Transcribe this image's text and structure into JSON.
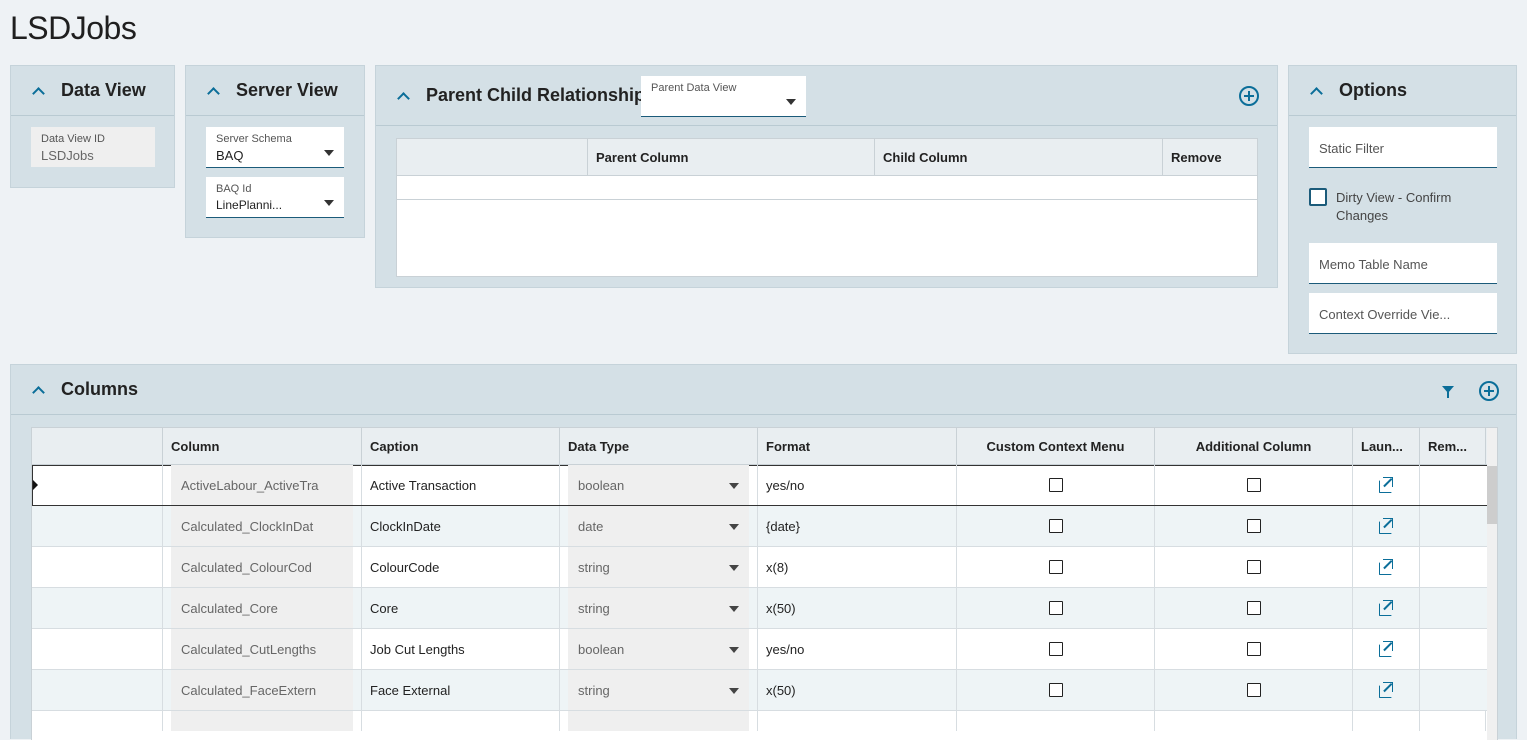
{
  "page": {
    "title": "LSDJobs"
  },
  "data_view": {
    "title": "Data View",
    "id_label": "Data View ID",
    "id_value": "LSDJobs"
  },
  "server_view": {
    "title": "Server View",
    "schema_label": "Server Schema",
    "schema_value": "BAQ",
    "baq_label": "BAQ Id",
    "baq_value": "LinePlanni..."
  },
  "parent_child": {
    "title": "Parent Child Relationships",
    "parent_dv_label": "Parent Data View",
    "parent_dv_value": "",
    "headers": [
      "",
      "Parent Column",
      "Child Column",
      "Remove"
    ]
  },
  "options": {
    "title": "Options",
    "static_filter": "Static Filter",
    "dirty_view_label": "Dirty View - Confirm Changes",
    "dirty_view_checked": false,
    "memo_table": "Memo Table Name",
    "context_override": "Context Override Vie..."
  },
  "columns": {
    "title": "Columns",
    "headers": [
      "",
      "Column",
      "Caption",
      "Data Type",
      "Format",
      "Custom Context Menu",
      "Additional Column",
      "Laun...",
      "Rem..."
    ],
    "rows": [
      {
        "column": "ActiveLabour_ActiveTra",
        "caption": "Active Transaction",
        "data_type": "boolean",
        "format": "yes/no",
        "custom_ctx": false,
        "additional": false
      },
      {
        "column": "Calculated_ClockInDat",
        "caption": "ClockInDate",
        "data_type": "date",
        "format": "{date}",
        "custom_ctx": false,
        "additional": false
      },
      {
        "column": "Calculated_ColourCod",
        "caption": "ColourCode",
        "data_type": "string",
        "format": "x(8)",
        "custom_ctx": false,
        "additional": false
      },
      {
        "column": "Calculated_Core",
        "caption": "Core",
        "data_type": "string",
        "format": "x(50)",
        "custom_ctx": false,
        "additional": false
      },
      {
        "column": "Calculated_CutLengths",
        "caption": "Job Cut Lengths",
        "data_type": "boolean",
        "format": "yes/no",
        "custom_ctx": false,
        "additional": false
      },
      {
        "column": "Calculated_FaceExtern",
        "caption": "Face External",
        "data_type": "string",
        "format": "x(50)",
        "custom_ctx": false,
        "additional": false
      }
    ]
  },
  "colors": {
    "accent": "#0b6e99",
    "panel": "#d4e0e6",
    "background": "#eef2f5"
  },
  "icons": [
    "chevron-up-icon",
    "plus-circle-icon",
    "filter-icon",
    "launch-icon",
    "dropdown-caret-icon"
  ]
}
